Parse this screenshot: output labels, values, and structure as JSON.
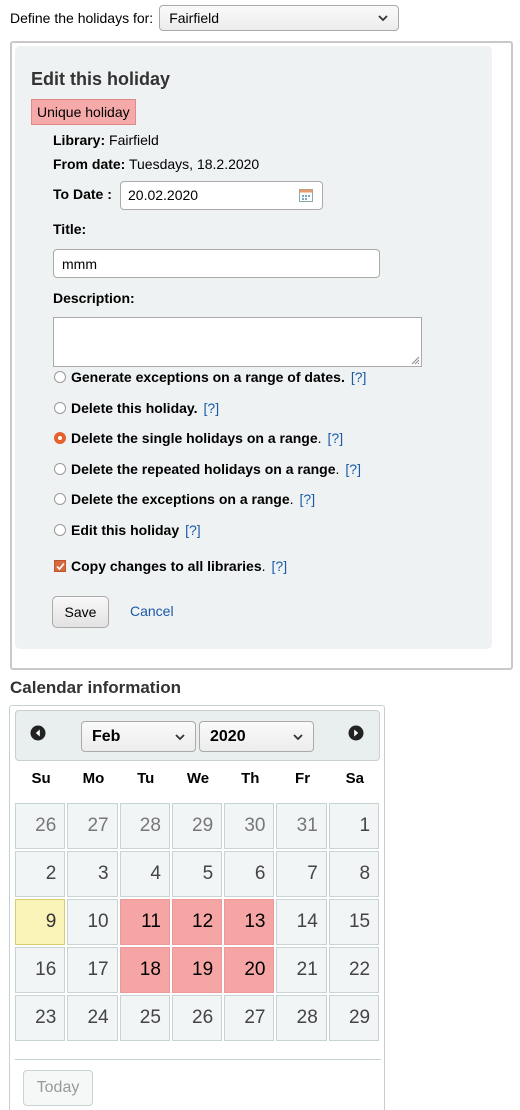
{
  "filter": {
    "label": "Define the holidays for:",
    "selected_library": "Fairfield"
  },
  "edit_panel": {
    "title": "Edit this holiday",
    "holiday_type": "Unique holiday",
    "library_label": "Library:",
    "library_value": "Fairfield",
    "from_date_label": "From date:",
    "from_date_value": "Tuesdays, 18.2.2020",
    "to_date_label": "To Date :",
    "to_date_value": "20.02.2020",
    "title_label": "Title:",
    "title_value": "mmm",
    "description_label": "Description:",
    "description_value": "",
    "options": [
      {
        "label": "Generate exceptions on a range of dates.",
        "suffix": "",
        "help": "[?]",
        "checked": false
      },
      {
        "label": "Delete this holiday.",
        "suffix": "",
        "help": "[?]",
        "checked": false
      },
      {
        "label": "Delete the single holidays on a range",
        "suffix": ".",
        "help": "[?]",
        "checked": true
      },
      {
        "label": "Delete the repeated holidays on a range",
        "suffix": ".",
        "help": "[?]",
        "checked": false
      },
      {
        "label": "Delete the exceptions on a range",
        "suffix": ".",
        "help": "[?]",
        "checked": false
      },
      {
        "label": "Edit this holiday",
        "suffix": "",
        "help": "[?]",
        "checked": false
      }
    ],
    "copy_all": {
      "label": "Copy changes to all libraries",
      "suffix": ".",
      "help": "[?]",
      "checked": true
    },
    "save_label": "Save",
    "cancel_label": "Cancel"
  },
  "calendar": {
    "heading": "Calendar information",
    "month": "Feb",
    "year": "2020",
    "weekdays": [
      "Su",
      "Mo",
      "Tu",
      "We",
      "Th",
      "Fr",
      "Sa"
    ],
    "days": [
      {
        "n": "26",
        "state": "muted"
      },
      {
        "n": "27",
        "state": "muted"
      },
      {
        "n": "28",
        "state": "muted"
      },
      {
        "n": "29",
        "state": "muted"
      },
      {
        "n": "30",
        "state": "muted"
      },
      {
        "n": "31",
        "state": "muted"
      },
      {
        "n": "1",
        "state": "normal"
      },
      {
        "n": "2",
        "state": "normal"
      },
      {
        "n": "3",
        "state": "normal"
      },
      {
        "n": "4",
        "state": "normal"
      },
      {
        "n": "5",
        "state": "normal"
      },
      {
        "n": "6",
        "state": "normal"
      },
      {
        "n": "7",
        "state": "normal"
      },
      {
        "n": "8",
        "state": "normal"
      },
      {
        "n": "9",
        "state": "today"
      },
      {
        "n": "10",
        "state": "normal"
      },
      {
        "n": "11",
        "state": "holiday"
      },
      {
        "n": "12",
        "state": "holiday"
      },
      {
        "n": "13",
        "state": "holiday"
      },
      {
        "n": "14",
        "state": "normal"
      },
      {
        "n": "15",
        "state": "normal"
      },
      {
        "n": "16",
        "state": "normal"
      },
      {
        "n": "17",
        "state": "normal"
      },
      {
        "n": "18",
        "state": "holiday"
      },
      {
        "n": "19",
        "state": "holiday"
      },
      {
        "n": "20",
        "state": "holiday"
      },
      {
        "n": "21",
        "state": "normal"
      },
      {
        "n": "22",
        "state": "normal"
      },
      {
        "n": "23",
        "state": "normal"
      },
      {
        "n": "24",
        "state": "normal"
      },
      {
        "n": "25",
        "state": "normal"
      },
      {
        "n": "26",
        "state": "normal"
      },
      {
        "n": "27",
        "state": "normal"
      },
      {
        "n": "28",
        "state": "normal"
      },
      {
        "n": "29",
        "state": "normal"
      }
    ],
    "today_button": "Today"
  },
  "colors": {
    "holiday": "#f6a5a5",
    "today": "#fbf4b8",
    "link": "#1a5aa8",
    "accent": "#e5622e"
  }
}
